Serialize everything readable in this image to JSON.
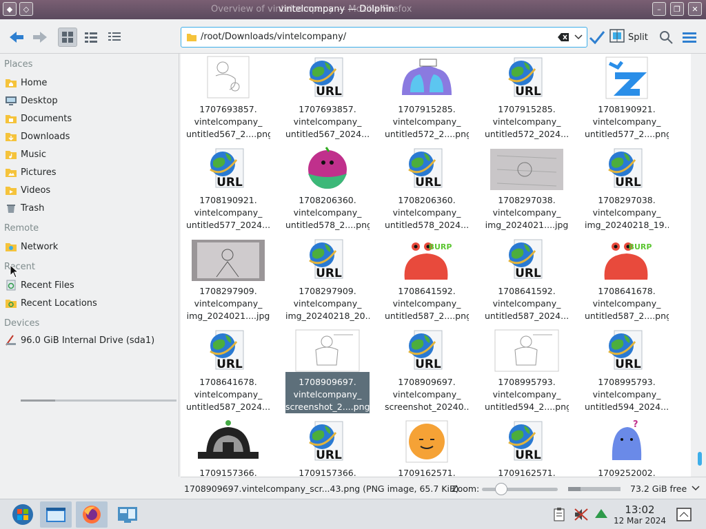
{
  "window": {
    "background_title": "Overview of vintelcompany — Mozilla Firefox",
    "title": "vintelcompany — Dolphin"
  },
  "toolbar": {
    "path": "/root/Downloads/vintelcompany/",
    "split_label": "Split"
  },
  "sidebar": {
    "sections": [
      {
        "title": "Places",
        "items": [
          {
            "label": "Home",
            "icon": "home-folder-icon"
          },
          {
            "label": "Desktop",
            "icon": "desktop-icon"
          },
          {
            "label": "Documents",
            "icon": "documents-folder-icon"
          },
          {
            "label": "Downloads",
            "icon": "downloads-folder-icon"
          },
          {
            "label": "Music",
            "icon": "music-folder-icon"
          },
          {
            "label": "Pictures",
            "icon": "pictures-folder-icon"
          },
          {
            "label": "Videos",
            "icon": "videos-folder-icon"
          },
          {
            "label": "Trash",
            "icon": "trash-icon"
          }
        ]
      },
      {
        "title": "Remote",
        "items": [
          {
            "label": "Network",
            "icon": "network-folder-icon"
          }
        ]
      },
      {
        "title": "Recent",
        "items": [
          {
            "label": "Recent Files",
            "icon": "recent-files-icon"
          },
          {
            "label": "Recent Locations",
            "icon": "recent-locations-icon"
          }
        ]
      },
      {
        "title": "Devices",
        "items": [
          {
            "label": "96.0 GiB Internal Drive (sda1)",
            "icon": "drive-icon",
            "usage": 0.22
          }
        ]
      }
    ]
  },
  "files": [
    {
      "l1": "1707693857.",
      "l2": "vintelcompany_",
      "l3": "untitled567_2....png",
      "thumb": "sketch"
    },
    {
      "l1": "1707693857.",
      "l2": "vintelcompany_",
      "l3": "untitled567_2024...",
      "thumb": "url"
    },
    {
      "l1": "1707915285.",
      "l2": "vintelcompany_",
      "l3": "untitled572_2....png",
      "thumb": "blue-blob"
    },
    {
      "l1": "1707915285.",
      "l2": "vintelcompany_",
      "l3": "untitled572_2024...",
      "thumb": "url"
    },
    {
      "l1": "1708190921.",
      "l2": "vintelcompany_",
      "l3": "untitled577_2....png",
      "thumb": "blue-z"
    },
    {
      "l1": "1708190921.",
      "l2": "vintelcompany_",
      "l3": "untitled577_2024...",
      "thumb": "url"
    },
    {
      "l1": "1708206360.",
      "l2": "vintelcompany_",
      "l3": "untitled578_2....png",
      "thumb": "pink-ball"
    },
    {
      "l1": "1708206360.",
      "l2": "vintelcompany_",
      "l3": "untitled578_2024...",
      "thumb": "url"
    },
    {
      "l1": "1708297038.",
      "l2": "vintelcompany_",
      "l3": "img_2024021....jpg",
      "thumb": "photo"
    },
    {
      "l1": "1708297038.",
      "l2": "vintelcompany_",
      "l3": "img_20240218_19...",
      "thumb": "url"
    },
    {
      "l1": "1708297909.",
      "l2": "vintelcompany_",
      "l3": "img_2024021....jpg",
      "thumb": "photo-dark"
    },
    {
      "l1": "1708297909.",
      "l2": "vintelcompany_",
      "l3": "img_20240218_20...",
      "thumb": "url"
    },
    {
      "l1": "1708641592.",
      "l2": "vintelcompany_",
      "l3": "untitled587_2....png",
      "thumb": "red-crab"
    },
    {
      "l1": "1708641592.",
      "l2": "vintelcompany_",
      "l3": "untitled587_2024...",
      "thumb": "url"
    },
    {
      "l1": "1708641678.",
      "l2": "vintelcompany_",
      "l3": "untitled587_2....png",
      "thumb": "red-crab"
    },
    {
      "l1": "1708641678.",
      "l2": "vintelcompany_",
      "l3": "untitled587_2024...",
      "thumb": "url"
    },
    {
      "l1": "1708909697.",
      "l2": "vintelcompany_",
      "l3": "screenshot_2....png",
      "thumb": "sketch-wide",
      "selected": true
    },
    {
      "l1": "1708909697.",
      "l2": "vintelcompany_",
      "l3": "screenshot_20240...",
      "thumb": "url"
    },
    {
      "l1": "1708995793.",
      "l2": "vintelcompany_",
      "l3": "untitled594_2....png",
      "thumb": "sketch-wide"
    },
    {
      "l1": "1708995793.",
      "l2": "vintelcompany_",
      "l3": "untitled594_2024...",
      "thumb": "url"
    },
    {
      "l1": "1709157366.",
      "l2": "",
      "l3": "",
      "thumb": "robot"
    },
    {
      "l1": "1709157366.",
      "l2": "",
      "l3": "",
      "thumb": "url"
    },
    {
      "l1": "1709162571.",
      "l2": "",
      "l3": "",
      "thumb": "orange-face"
    },
    {
      "l1": "1709162571.",
      "l2": "",
      "l3": "",
      "thumb": "url"
    },
    {
      "l1": "1709252002.",
      "l2": "",
      "l3": "",
      "thumb": "blue-ghost"
    }
  ],
  "url_badge": "URL",
  "burp_text": "BURP!",
  "statusbar": {
    "info": "1708909697.vintelcompany_scr...43.png (PNG image, 65.7 KiB)",
    "zoom_label": "Zoom:",
    "zoom_level": 0.25,
    "free_space": "73.2 GiB free",
    "free_fraction": 0.24
  },
  "taskbar": {
    "time": "13:02",
    "date": "12 Mar 2024"
  },
  "colors": {
    "accent": "#3daee9",
    "selection": "#5d6f7a",
    "folder": "#f5c33b"
  }
}
